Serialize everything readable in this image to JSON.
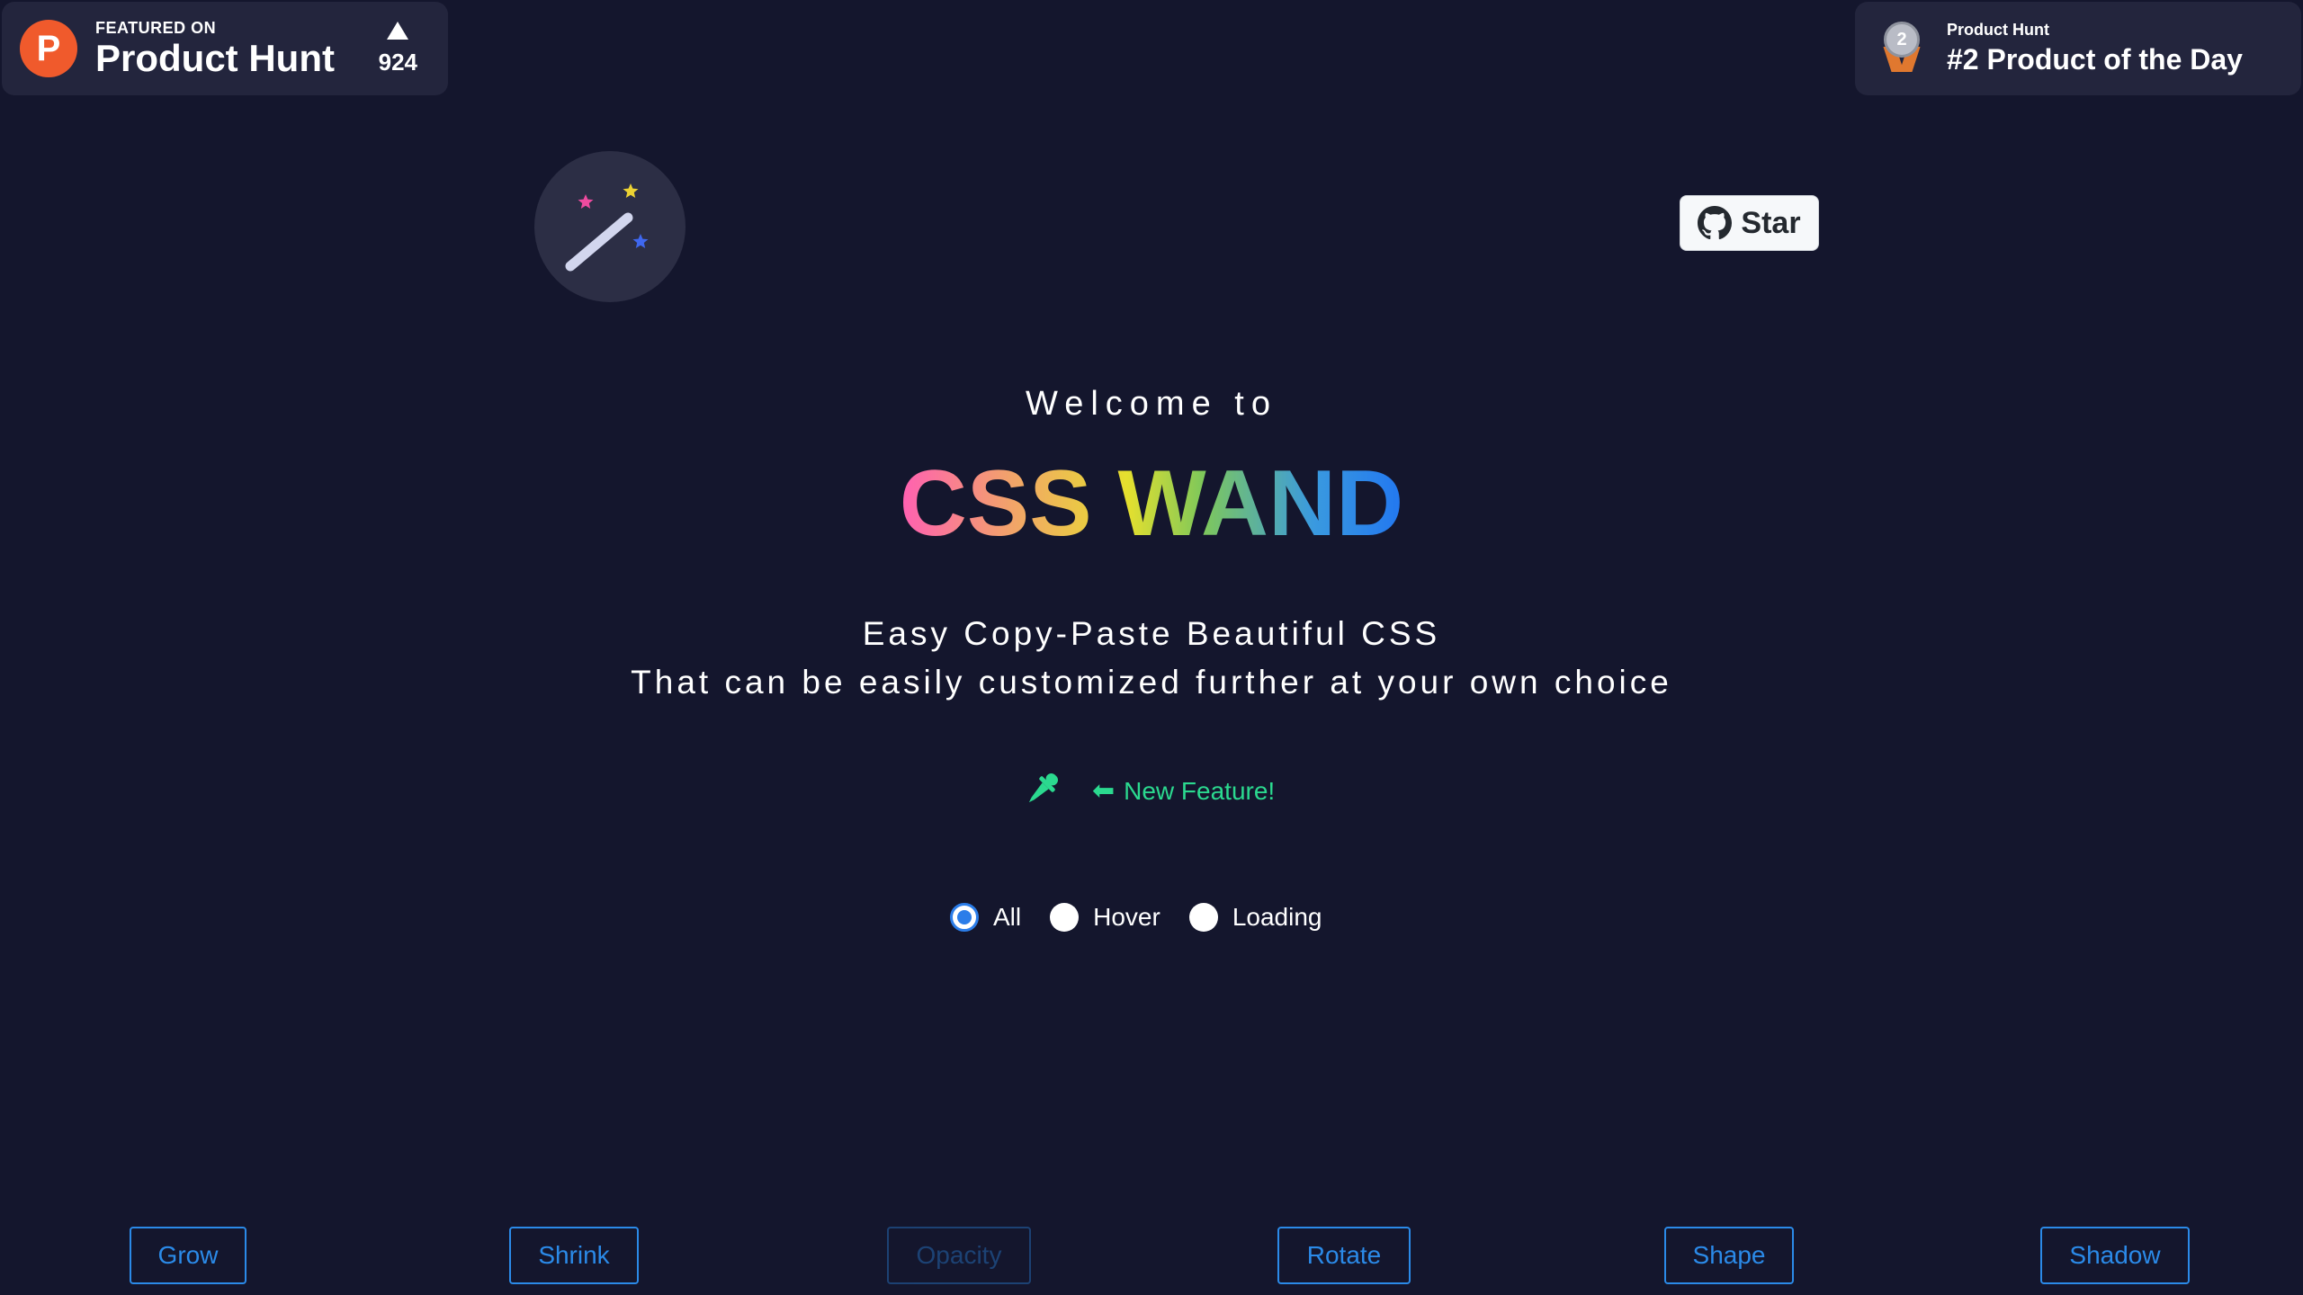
{
  "product_hunt": {
    "featured_on": "FEATURED ON",
    "name": "Product Hunt",
    "logo_letter": "P",
    "votes": "924"
  },
  "award": {
    "source": "Product Hunt",
    "title": "#2 Product of the Day",
    "rank": "2"
  },
  "github": {
    "star_label": "Star"
  },
  "hero": {
    "welcome": "Welcome to",
    "brand": "CSS WAND",
    "tagline_1": "Easy Copy-Paste Beautiful CSS",
    "tagline_2": "That can be easily customized further at your own choice"
  },
  "new_feature": {
    "label": "New Feature!"
  },
  "filters": {
    "selected": "All",
    "options": [
      "All",
      "Hover",
      "Loading"
    ]
  },
  "effects": [
    "Grow",
    "Shrink",
    "Opacity",
    "Rotate",
    "Shape",
    "Shadow"
  ],
  "colors": {
    "background": "#14162d",
    "accent_blue": "#2b8ae8",
    "feature_green": "#2bd98f",
    "product_hunt_orange": "#f05a2c"
  },
  "icons": {
    "logo": "magic-wand-icon",
    "github": "github-icon",
    "feature": "color-picker-icon",
    "arrow": "arrow-left-icon",
    "award": "medal-icon",
    "upvote": "upvote-arrow-icon"
  }
}
